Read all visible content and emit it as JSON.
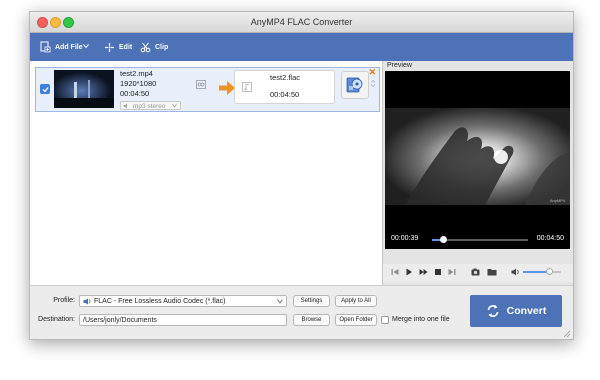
{
  "window": {
    "title": "AnyMP4 FLAC Converter"
  },
  "toolbar": {
    "add_file": "Add File",
    "edit": "Edit",
    "clip": "Clip"
  },
  "item": {
    "source_name": "test2.mp4",
    "resolution": "1920*1080",
    "duration": "00:04:50",
    "audio_track": "mp3 stereo",
    "target_name": "test2.flac",
    "target_duration": "00:04:50",
    "checked": true
  },
  "preview": {
    "label": "Preview",
    "time_current": "00:00:39",
    "time_total": "00:04:50",
    "progress": 0.13,
    "volume": 0.7,
    "watermark": "AnyMP4"
  },
  "bottom": {
    "profile_label": "Profile:",
    "profile_value": "FLAC - Free Lossless Audio Codec (*.flac)",
    "settings": "Settings",
    "apply_to_all": "Apply to All",
    "destination_label": "Destination:",
    "destination_value": "/Users/jonly/Documents",
    "browse": "Browse",
    "open_folder": "Open Folder",
    "merge_label": "Merge into one file",
    "convert": "Convert"
  },
  "colors": {
    "accent": "#4d72b8",
    "arrow": "#f0931f",
    "checkbox": "#3f7fe0"
  }
}
